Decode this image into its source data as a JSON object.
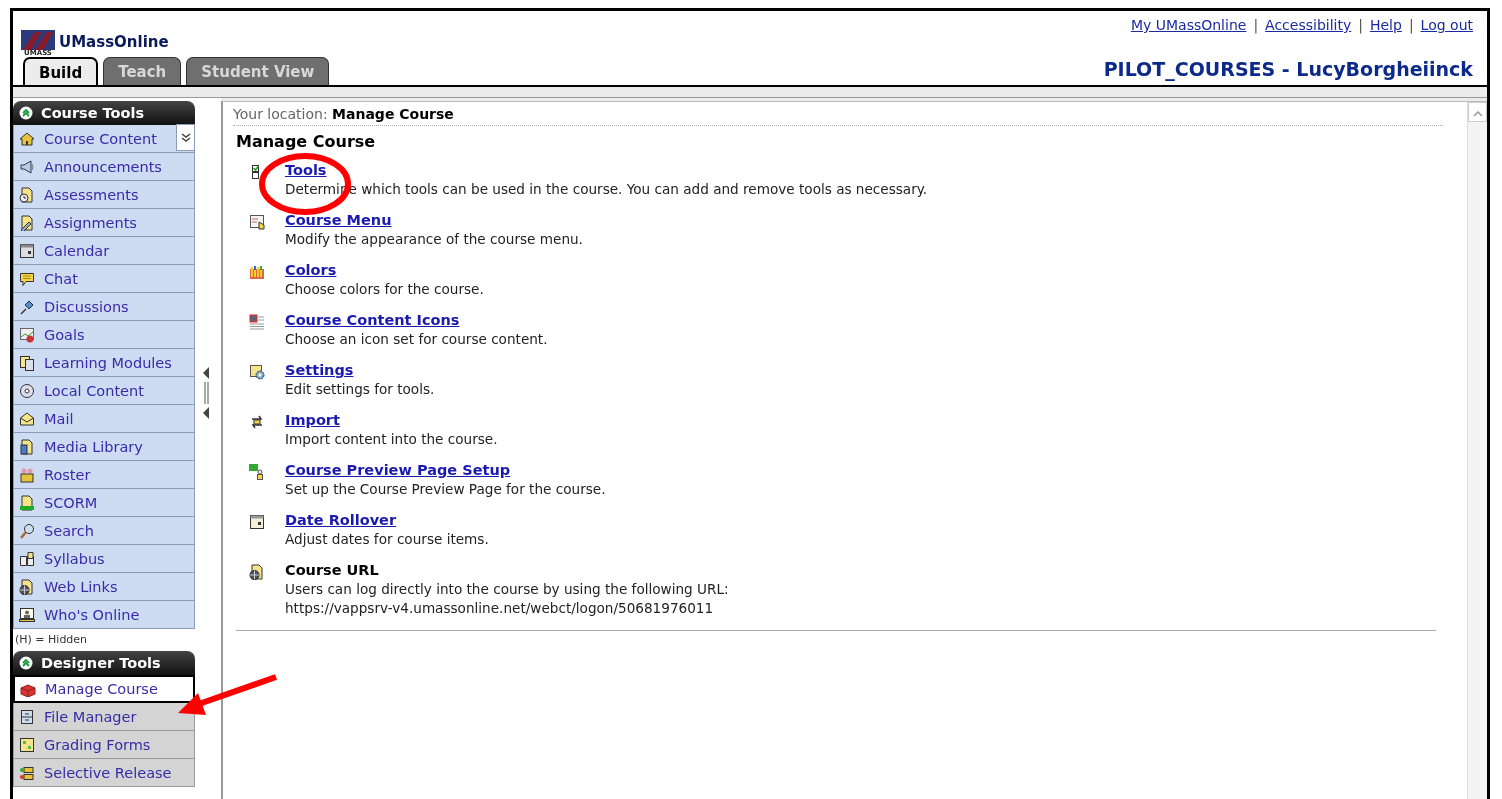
{
  "header": {
    "logo_caption": "UMASS",
    "logo_text": "UMassOnline",
    "top_links": [
      "My UMassOnline",
      "Accessibility",
      "Help",
      "Log out"
    ],
    "link_separators": [
      "|",
      "|",
      "|"
    ],
    "course_title": "PILOT_COURSES - LucyBorgheiinck",
    "tabs": [
      {
        "label": "Build",
        "selected": true
      },
      {
        "label": "Teach",
        "selected": false
      },
      {
        "label": "Student View",
        "selected": false
      }
    ]
  },
  "sidebar": {
    "sections": [
      {
        "title": "Course Tools",
        "expanded": true,
        "items": [
          {
            "label": "Course Content",
            "kind": "menu",
            "selected": false
          },
          {
            "label": "Announcements",
            "kind": "link",
            "selected": false
          },
          {
            "label": "Assessments",
            "kind": "link",
            "selected": false
          },
          {
            "label": "Assignments",
            "kind": "link",
            "selected": false
          },
          {
            "label": "Calendar",
            "kind": "link",
            "selected": false
          },
          {
            "label": "Chat",
            "kind": "link",
            "selected": false
          },
          {
            "label": "Discussions",
            "kind": "link",
            "selected": false
          },
          {
            "label": "Goals",
            "kind": "link",
            "selected": false
          },
          {
            "label": "Learning Modules",
            "kind": "link",
            "selected": false
          },
          {
            "label": "Local Content",
            "kind": "link",
            "selected": false
          },
          {
            "label": "Mail",
            "kind": "link",
            "selected": false
          },
          {
            "label": "Media Library",
            "kind": "link",
            "selected": false
          },
          {
            "label": "Roster",
            "kind": "link",
            "selected": false
          },
          {
            "label": "SCORM",
            "kind": "link",
            "selected": false
          },
          {
            "label": "Search",
            "kind": "link",
            "selected": false
          },
          {
            "label": "Syllabus",
            "kind": "link",
            "selected": false
          },
          {
            "label": "Web Links",
            "kind": "link",
            "selected": false
          },
          {
            "label": "Who's Online",
            "kind": "link",
            "selected": false
          }
        ],
        "note": "(H) = Hidden"
      },
      {
        "title": "Designer Tools",
        "expanded": true,
        "items": [
          {
            "label": "Manage Course",
            "kind": "link",
            "selected": true
          },
          {
            "label": "File Manager",
            "kind": "link",
            "selected": false
          },
          {
            "label": "Grading Forms",
            "kind": "link",
            "selected": false
          },
          {
            "label": "Selective Release",
            "kind": "link",
            "selected": false
          }
        ]
      }
    ]
  },
  "content": {
    "location_label": "Your location:",
    "location": "Manage Course",
    "heading": "Manage Course",
    "items": [
      {
        "kind": "link",
        "title": "Tools",
        "description": "Determine which tools can be used in the course. You can add and remove tools as necessary."
      },
      {
        "kind": "link",
        "title": "Course Menu",
        "description": "Modify the appearance of the course menu."
      },
      {
        "kind": "link",
        "title": "Colors",
        "description": "Choose colors for the course."
      },
      {
        "kind": "link",
        "title": "Course Content Icons",
        "description": "Choose an icon set for course content."
      },
      {
        "kind": "link",
        "title": "Settings",
        "description": "Edit settings for tools."
      },
      {
        "kind": "link",
        "title": "Import",
        "description": "Import content into the course."
      },
      {
        "kind": "link",
        "title": "Course Preview Page Setup",
        "description": "Set up the Course Preview Page for the course."
      },
      {
        "kind": "link",
        "title": "Date Rollover",
        "description": "Adjust dates for course items."
      },
      {
        "kind": "info",
        "title": "Course URL",
        "description": "Users can log directly into the course by using the following URL:",
        "url": "https://vappsrv-v4.umassonline.net/webct/logon/50681976011"
      }
    ]
  }
}
